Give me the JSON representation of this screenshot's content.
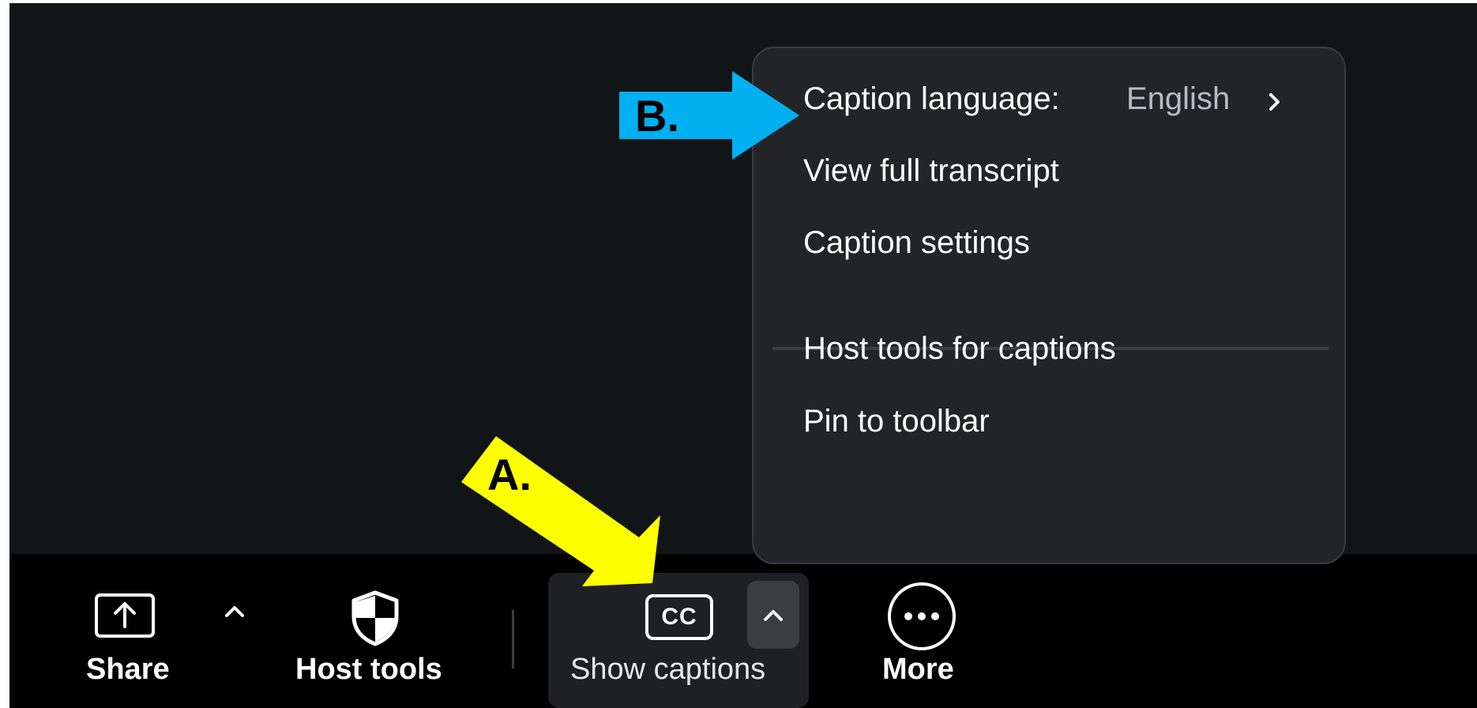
{
  "menu": {
    "caption_language_label": "Caption language:",
    "caption_language_value": "English",
    "items": [
      {
        "label": "View full transcript"
      },
      {
        "label": "Caption settings"
      },
      {
        "label": "Host tools for captions"
      },
      {
        "label": "Pin to toolbar"
      }
    ]
  },
  "toolbar": {
    "share_label": "Share",
    "host_tools_label": "Host tools",
    "show_captions_label": "Show captions",
    "cc_icon_text": "CC",
    "more_label": "More"
  },
  "annotations": {
    "a_label": "A.",
    "b_label": "B.",
    "a_color": "#ffff00",
    "b_color": "#00b0f0"
  },
  "colors": {
    "background": "#121518",
    "toolbar": "#000000",
    "menu": "#232427"
  },
  "icons": [
    "share-icon",
    "caret-up-icon",
    "shield-icon",
    "cc-icon",
    "more-icon",
    "chevron-right-icon"
  ]
}
